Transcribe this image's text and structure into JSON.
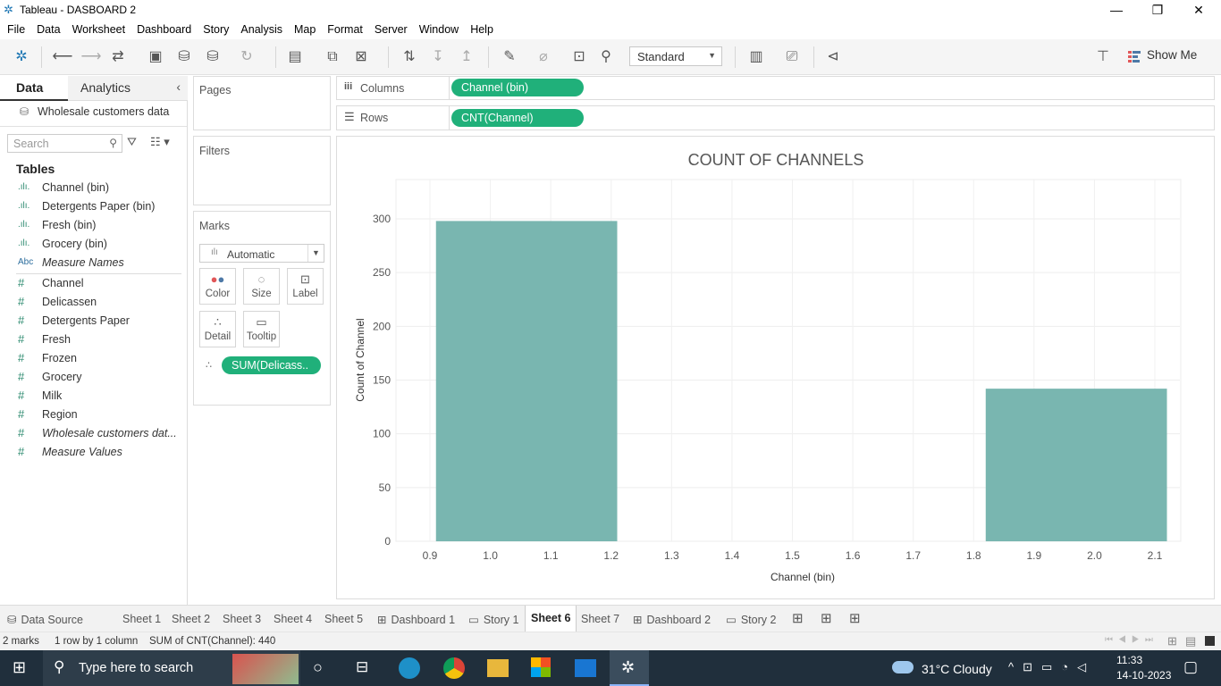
{
  "window": {
    "title": "Tableau - DASBOARD 2"
  },
  "menu": [
    "File",
    "Data",
    "Worksheet",
    "Dashboard",
    "Story",
    "Analysis",
    "Map",
    "Format",
    "Server",
    "Window",
    "Help"
  ],
  "toolbar": {
    "fit_mode": "Standard",
    "show_me": "Show Me"
  },
  "datapane": {
    "tabs": [
      "Data",
      "Analytics"
    ],
    "datasource": "Wholesale customers data",
    "search_placeholder": "Search",
    "tables_label": "Tables",
    "dimensions": [
      {
        "icon": ".ılı.",
        "name": "Channel (bin)",
        "italic": false
      },
      {
        "icon": ".ılı.",
        "name": "Detergents Paper (bin)",
        "italic": false
      },
      {
        "icon": ".ılı.",
        "name": "Fresh (bin)",
        "italic": false
      },
      {
        "icon": ".ılı.",
        "name": "Grocery (bin)",
        "italic": false
      },
      {
        "icon": "Abc",
        "name": "Measure Names",
        "italic": true
      }
    ],
    "measures": [
      {
        "icon": "#",
        "name": "Channel",
        "italic": false
      },
      {
        "icon": "#",
        "name": "Delicassen",
        "italic": false
      },
      {
        "icon": "#",
        "name": "Detergents Paper",
        "italic": false
      },
      {
        "icon": "#",
        "name": "Fresh",
        "italic": false
      },
      {
        "icon": "#",
        "name": "Frozen",
        "italic": false
      },
      {
        "icon": "#",
        "name": "Grocery",
        "italic": false
      },
      {
        "icon": "#",
        "name": "Milk",
        "italic": false
      },
      {
        "icon": "#",
        "name": "Region",
        "italic": false
      },
      {
        "icon": "#",
        "name": "Wholesale customers dat...",
        "italic": true
      },
      {
        "icon": "#",
        "name": "Measure Values",
        "italic": true
      }
    ]
  },
  "cards": {
    "pages": "Pages",
    "filters": "Filters",
    "marks": "Marks",
    "mark_type": "Automatic",
    "buttons": [
      "Color",
      "Size",
      "Label",
      "Detail",
      "Tooltip"
    ],
    "mark_pill": "SUM(Delicass.."
  },
  "shelves": {
    "columns_label": "Columns",
    "columns_pill": "Channel (bin)",
    "rows_label": "Rows",
    "rows_pill": "CNT(Channel)"
  },
  "chart_data": {
    "type": "bar",
    "title": "COUNT OF CHANNELS",
    "xlabel": "Channel (bin)",
    "ylabel": "Count of Channel",
    "x_ticks": [
      "0.9",
      "1.0",
      "1.1",
      "1.2",
      "1.3",
      "1.4",
      "1.5",
      "1.6",
      "1.7",
      "1.8",
      "1.9",
      "2.0",
      "2.1"
    ],
    "xlim": [
      0.9,
      2.1
    ],
    "ylim": [
      0,
      300
    ],
    "y_ticks": [
      0,
      50,
      100,
      150,
      200,
      250,
      300
    ],
    "bars": [
      {
        "x_start": 0.91,
        "x_end": 1.21,
        "value": 298
      },
      {
        "x_start": 1.82,
        "x_end": 2.12,
        "value": 142
      }
    ],
    "bar_color": "#79b6b0",
    "grid": true
  },
  "sheet_tabs": [
    {
      "label": "Data Source",
      "icon": "⛁",
      "active": false
    },
    {
      "label": "Sheet 1",
      "icon": "",
      "active": false
    },
    {
      "label": "Sheet 2",
      "icon": "",
      "active": false
    },
    {
      "label": "Sheet 3",
      "icon": "",
      "active": false
    },
    {
      "label": "Sheet 4",
      "icon": "",
      "active": false
    },
    {
      "label": "Sheet 5",
      "icon": "",
      "active": false
    },
    {
      "label": "Dashboard 1",
      "icon": "⊞",
      "active": false
    },
    {
      "label": "Story 1",
      "icon": "▭",
      "active": false
    },
    {
      "label": "Sheet 6",
      "icon": "",
      "active": true
    },
    {
      "label": "Sheet 7",
      "icon": "",
      "active": false
    },
    {
      "label": "Dashboard 2",
      "icon": "⊞",
      "active": false
    },
    {
      "label": "Story 2",
      "icon": "▭",
      "active": false
    }
  ],
  "status": {
    "marks": "2 marks",
    "layout": "1 row by 1 column",
    "sum": "SUM of CNT(Channel): 440"
  },
  "taskbar": {
    "search_placeholder": "Type here to search",
    "weather": "31°C  Cloudy",
    "time": "11:33",
    "date": "14-10-2023"
  },
  "colors": {
    "pill": "#20b07a",
    "bar": "#79b6b0",
    "taskbar": "#202f3c"
  }
}
